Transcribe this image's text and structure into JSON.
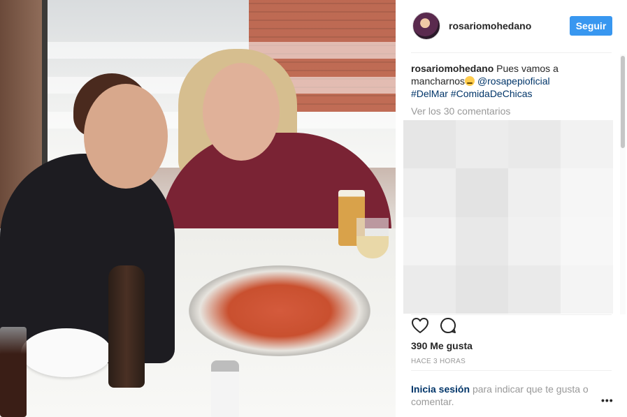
{
  "post": {
    "username": "rosariomohedano",
    "follow_label": "Seguir",
    "caption": {
      "text_before": "Pues vamos a mancharnos",
      "emoji": "smirk-face-emoji",
      "mention": "@rosapepioficial",
      "hashtags": [
        "#DelMar",
        "#ComidaDeChicas"
      ]
    },
    "view_comments": "Ver los 30 comentarios",
    "likes": "390 Me gusta",
    "time_ago": "HACE 3 HORAS"
  },
  "login_prompt": {
    "link": "Inicia sesión",
    "rest": "para indicar que te gusta o comentar."
  },
  "icons": {
    "like": "heart-icon",
    "comment": "comment-icon",
    "more": "more-options-icon"
  },
  "colors": {
    "follow_button": "#3897f0",
    "link": "#003569",
    "muted": "#999999",
    "text": "#262626"
  }
}
